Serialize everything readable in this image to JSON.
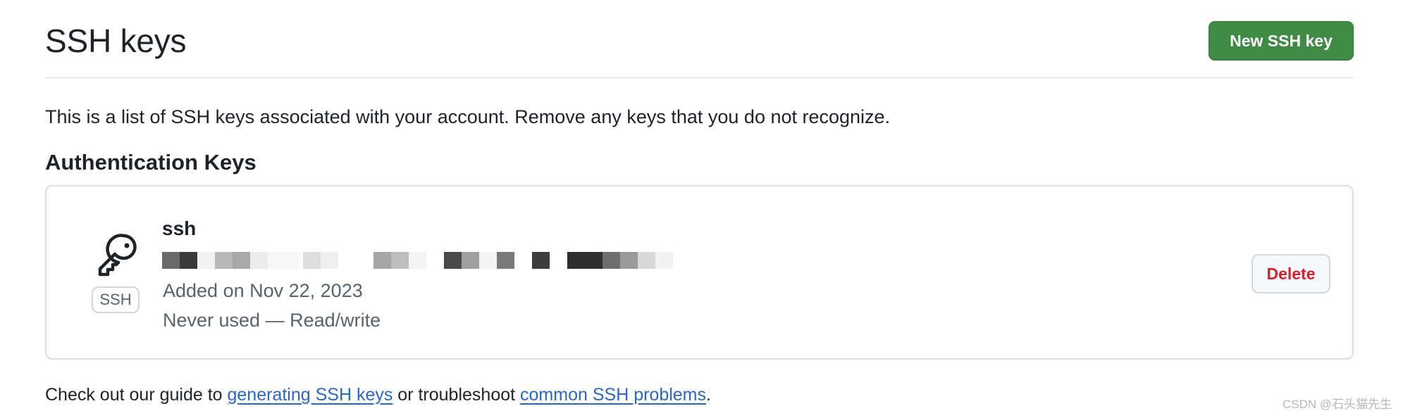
{
  "header": {
    "title": "SSH keys",
    "new_key_label": "New SSH key"
  },
  "intro_text": "This is a list of SSH keys associated with your account. Remove any keys that you do not recognize.",
  "section_title": "Authentication Keys",
  "key": {
    "badge": "SSH",
    "title": "ssh",
    "added": "Added on Nov 22, 2023",
    "usage": "Never used — Read/write",
    "delete_label": "Delete",
    "icon": "key-icon"
  },
  "footer": {
    "prefix": "Check out our guide to ",
    "link1": "generating SSH keys",
    "middle": " or troubleshoot ",
    "link2": "common SSH problems",
    "suffix": "."
  },
  "watermark": "CSDN @石头猫先生",
  "colors": {
    "primary_button": "#3f8b46",
    "danger_text": "#cf222e",
    "link": "#2b68c5",
    "muted_text": "#59636e"
  }
}
